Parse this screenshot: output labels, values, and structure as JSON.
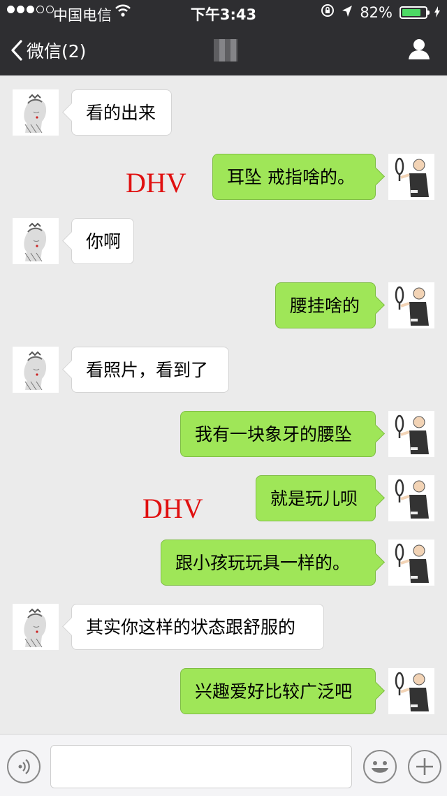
{
  "status": {
    "carrier": "中国电信",
    "time": "下午3:43",
    "battery": "82%",
    "battery_level": 0.82
  },
  "nav": {
    "back_label": "微信(2)"
  },
  "messages": [
    {
      "side": "in",
      "text": "看的出来"
    },
    {
      "side": "out",
      "text": "耳坠 戒指啥的。"
    },
    {
      "side": "in",
      "text": "你啊"
    },
    {
      "side": "out",
      "text": "腰挂啥的"
    },
    {
      "side": "in",
      "text": "看照片，看到了"
    },
    {
      "side": "out",
      "text": "我有一块象牙的腰坠"
    },
    {
      "side": "out",
      "text": "就是玩儿呗"
    },
    {
      "side": "out",
      "text": "跟小孩玩玩具一样的。"
    },
    {
      "side": "in",
      "text": "其实你这样的状态跟舒服的"
    },
    {
      "side": "out",
      "text": "兴趣爱好比较广泛吧"
    }
  ],
  "watermarks": [
    "DHV",
    "DHV"
  ],
  "colors": {
    "outgoing_bubble": "#9fe658",
    "incoming_bubble": "#ffffff",
    "header": "#2e2e31",
    "watermark": "#e01010"
  },
  "icons": [
    "back-chevron-icon",
    "profile-icon",
    "voice-icon",
    "emoji-icon",
    "plus-icon",
    "wifi-icon",
    "lock-rotation-icon",
    "location-arrow-icon"
  ]
}
